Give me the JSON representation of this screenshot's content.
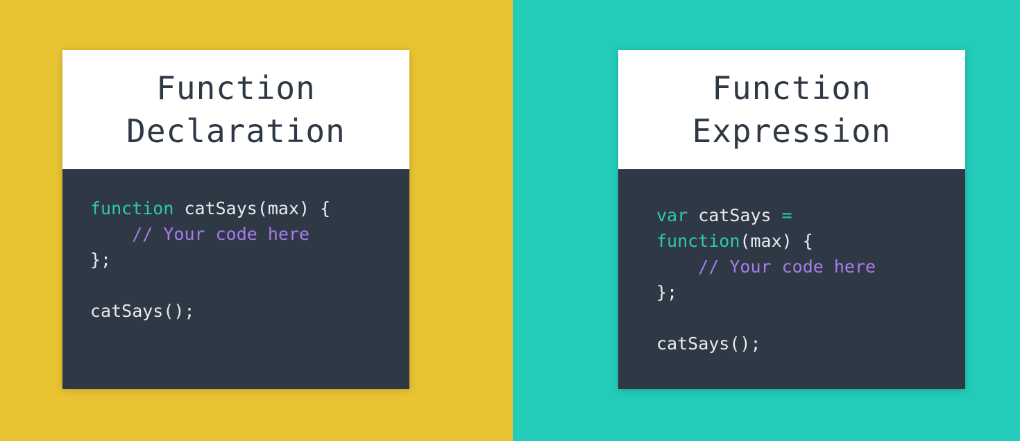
{
  "colors": {
    "left_bg": "#E8C433",
    "right_bg": "#23CBB9",
    "card_head": "#FFFFFF",
    "code_bg": "#2F3945",
    "title_text": "#2F3945",
    "code_text": "#E8ECEF",
    "keyword": "#2FC7B2",
    "comment": "#A87BEA"
  },
  "left_card": {
    "title_line1": "Function",
    "title_line2": "Declaration",
    "code": {
      "l1_keyword": "function",
      "l1_rest": " catSays(max) {",
      "l2_indent": "    ",
      "l2_comment": "// Your code here",
      "l3": "};",
      "l5": "catSays();"
    }
  },
  "right_card": {
    "title_line1": "Function",
    "title_line2": "Expression",
    "code": {
      "l1_keyword": "var",
      "l1_rest": " catSays ",
      "l1_op": "=",
      "l2_keyword": "function",
      "l2_rest": "(max) {",
      "l3_indent": "    ",
      "l3_comment": "// Your code here",
      "l4": "};",
      "l6": "catSays();"
    }
  }
}
